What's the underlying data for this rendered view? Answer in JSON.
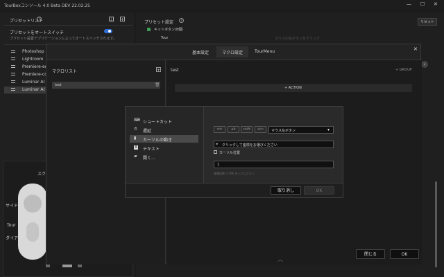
{
  "window": {
    "title": "TourBoxコンソール 4.0 Beta DEV 22.02.25"
  },
  "left_panel": {
    "header": "プリセットリスト",
    "auto_switch_label": "プリセットをオートスイッチ",
    "auto_switch_desc": "プリセット設置アプリケーションによってオートスイッチされます。",
    "presets": [
      "Photoshop",
      "Lightroom",
      "Premiere-edit",
      "Premiere-colo",
      "Luminar AI",
      "Luminar AI pr"
    ],
    "device_label": "スク",
    "side_labels": [
      "サイド",
      "Tour",
      "ダイアル"
    ]
  },
  "right_panel": {
    "header": "プリセット設定",
    "reset_label": "リセット",
    "subheader": "キットボタン(8個)",
    "tour_label": "Tour",
    "faded_text": "マウスの左ボタンをクリック"
  },
  "dialog": {
    "tabs": [
      "基本設定",
      "マクロ設定",
      "TourMenu"
    ],
    "active_tab": 1,
    "macro_list_title": "マクロリスト",
    "macro_items": [
      "test"
    ],
    "macro_name": "test",
    "group_label": "GROUP",
    "action_label": "ACTION",
    "close_label": "閉じる",
    "ok_label": "OK"
  },
  "action_dialog": {
    "options": [
      {
        "icon": "keyboard-icon",
        "label": "ショートカット"
      },
      {
        "icon": "stopwatch-icon",
        "label": "遅延"
      },
      {
        "icon": "mouse-icon",
        "label": "カーソルの動き"
      },
      {
        "icon": "text-icon",
        "label": "テキスト"
      },
      {
        "icon": "folder-icon",
        "label": "開く..."
      }
    ],
    "selected_index": 2,
    "modifier_keys": [
      "ctrl",
      "alt",
      "shift",
      "win"
    ],
    "mouse_select": "マウス左ボタン",
    "coord_placeholder": "クリックして座標をお選びください",
    "cursor_position_label": "カーソル位置",
    "repeat_value": "1",
    "repeat_hint": "重複回数 (1-99) を入力ください",
    "cancel_label": "取り消し",
    "ok_label": "OK"
  }
}
